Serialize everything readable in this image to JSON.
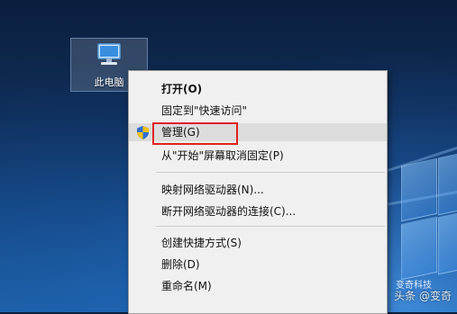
{
  "desktop": {
    "icon_label": "此电脑"
  },
  "context_menu": {
    "items": [
      {
        "label": "打开(O)",
        "bold": true
      },
      {
        "label": "固定到\"快速访问\""
      },
      {
        "label": "管理(G)",
        "icon": "shield-icon",
        "highlighted": true
      },
      {
        "label": "从\"开始\"屏幕取消固定(P)"
      },
      {
        "label": "映射网络驱动器(N)..."
      },
      {
        "label": "断开网络驱动器的连接(C)..."
      },
      {
        "label": "创建快捷方式(S)"
      },
      {
        "label": "删除(D)"
      },
      {
        "label": "重命名(M)"
      }
    ]
  },
  "watermark": {
    "brand": "变奇科技",
    "text": "头条 @变奇"
  },
  "colors": {
    "highlight_border": "#e02020",
    "menu_background": "#f0f0f0",
    "menu_hover": "#dcdcdc"
  }
}
